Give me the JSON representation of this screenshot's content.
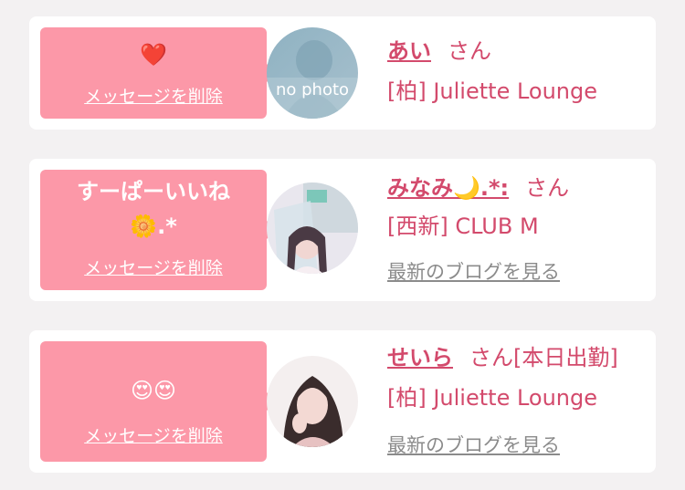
{
  "colors": {
    "accent": "#d34a6c",
    "bubble": "#fc98a8",
    "card": "#ffffff",
    "background": "#f3f1f2",
    "link_gray": "#8b8b8b"
  },
  "cards": [
    {
      "message": "❤️",
      "delete_label": "メッセージを削除",
      "avatar": "no-photo",
      "avatar_text": "no photo",
      "name": "あい",
      "suffix": "さん",
      "shop": "[柏] Juliette Lounge"
    },
    {
      "message_line1": "すーぱーいいね",
      "message_line2": "🌼.*",
      "delete_label": "メッセージを削除",
      "avatar": "photo-girl",
      "name": "みなみ🌙.*:",
      "suffix": "さん",
      "shop": "[西新] CLUB M",
      "blog_link": "最新のブログを見る"
    },
    {
      "message": "😍😍",
      "delete_label": "メッセージを削除",
      "avatar": "photo-girl",
      "name": "せいら",
      "suffix": "さん[本日出勤]",
      "shop": "[柏] Juliette Lounge",
      "blog_link": "最新のブログを見る"
    }
  ]
}
